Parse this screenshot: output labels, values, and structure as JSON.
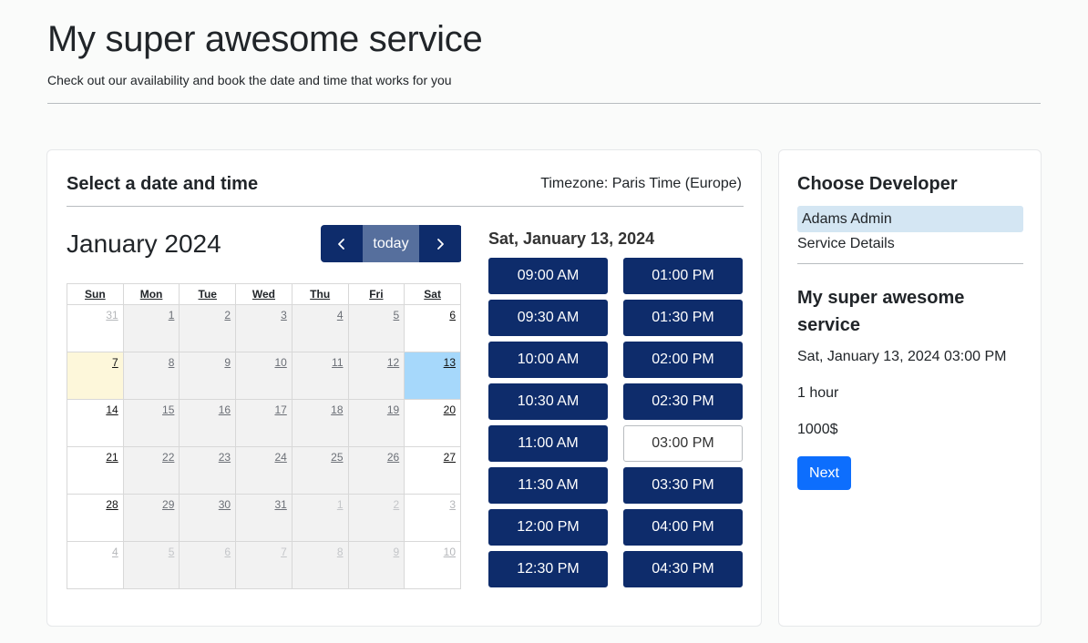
{
  "header": {
    "title": "My super awesome service",
    "subtitle": "Check out our availability and book the date and time that works for you"
  },
  "booking": {
    "section_title": "Select a date and time",
    "timezone": "Timezone: Paris Time (Europe)"
  },
  "calendar": {
    "month_title": "January 2024",
    "today_label": "today",
    "prev_icon": "chevron-left-icon",
    "next_icon": "chevron-right-icon",
    "weekdays": [
      "Sun",
      "Mon",
      "Tue",
      "Wed",
      "Thu",
      "Fri",
      "Sat"
    ],
    "weeks": [
      [
        "31",
        "1",
        "2",
        "3",
        "4",
        "5",
        "6"
      ],
      [
        "7",
        "8",
        "9",
        "10",
        "11",
        "12",
        "13"
      ],
      [
        "14",
        "15",
        "16",
        "17",
        "18",
        "19",
        "20"
      ],
      [
        "21",
        "22",
        "23",
        "24",
        "25",
        "26",
        "27"
      ],
      [
        "28",
        "29",
        "30",
        "31",
        "1",
        "2",
        "3"
      ],
      [
        "4",
        "5",
        "6",
        "7",
        "8",
        "9",
        "10"
      ]
    ],
    "today": "7",
    "selected": "13"
  },
  "slots": {
    "heading": "Sat, January 13, 2024",
    "times": [
      "09:00 AM",
      "01:00 PM",
      "09:30 AM",
      "01:30 PM",
      "10:00 AM",
      "02:00 PM",
      "10:30 AM",
      "02:30 PM",
      "11:00 AM",
      "03:00 PM",
      "11:30 AM",
      "03:30 PM",
      "12:00 PM",
      "04:00 PM",
      "12:30 PM",
      "04:30 PM"
    ],
    "selected": "03:00 PM"
  },
  "sidebar": {
    "title": "Choose Developer",
    "developer": "Adams Admin",
    "details_label": "Service Details",
    "service_name": "My super awesome service",
    "datetime": "Sat, January 13, 2024 03:00 PM",
    "duration": "1 hour",
    "price": "1000$",
    "next_label": "Next"
  },
  "colors": {
    "primary_navy": "#0e2c6b",
    "today_button": "#566f9d",
    "selected_day": "#a6d8fb",
    "today_day": "#fdf7da",
    "next_button": "#0d6efd",
    "developer_highlight": "#d4e6f3"
  }
}
